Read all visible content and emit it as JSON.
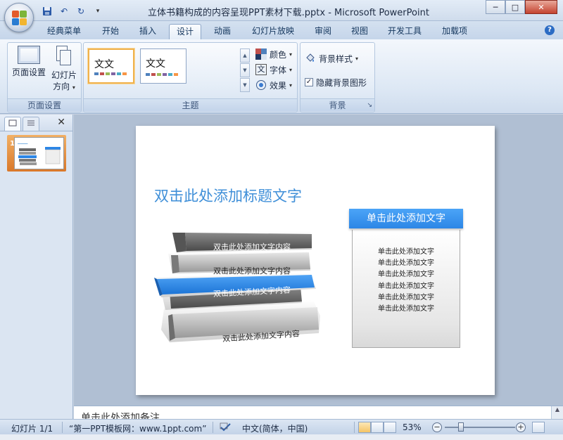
{
  "window": {
    "title": "立体书籍构成的内容呈现PPT素材下载.pptx - Microsoft PowerPoint",
    "minimize": "─",
    "maximize": "□",
    "close": "✕"
  },
  "quick_access": {
    "save_icon": "save-icon",
    "undo_label": "↶",
    "redo_label": "↻",
    "customize_label": "▾"
  },
  "tabs": [
    {
      "label": "经典菜单",
      "active": false
    },
    {
      "label": "开始",
      "active": false
    },
    {
      "label": "插入",
      "active": false
    },
    {
      "label": "设计",
      "active": true
    },
    {
      "label": "动画",
      "active": false
    },
    {
      "label": "幻灯片放映",
      "active": false
    },
    {
      "label": "审阅",
      "active": false
    },
    {
      "label": "视图",
      "active": false
    },
    {
      "label": "开发工具",
      "active": false
    },
    {
      "label": "加载项",
      "active": false
    }
  ],
  "help": "?",
  "ribbon": {
    "page_setup": {
      "group_label": "页面设置",
      "page_setup_label": "页面设置",
      "orientation_label_line1": "幻灯片",
      "orientation_label_line2": "方向",
      "orientation_caret": "▾"
    },
    "themes": {
      "group_label": "主题",
      "theme1_text": "文文",
      "theme2_text": "文文",
      "scroll_up": "▲",
      "scroll_down": "▼",
      "more": "▼",
      "colors_label": "颜色",
      "fonts_label": "字体",
      "effects_label": "效果",
      "fonts_icon_text": "文"
    },
    "background": {
      "group_label": "背景",
      "styles_label": "背景样式",
      "hide_graphics_label": "隐藏背景图形",
      "hide_graphics_checked": true,
      "check_mark": "✓",
      "launcher": "↘"
    }
  },
  "left_pane": {
    "close": "✕",
    "slide_number": "1"
  },
  "slide": {
    "title": "双击此处添加标题文字",
    "right_header": "单击此处添加文字",
    "right_lines": [
      "单击此处添加文字",
      "单击此处添加文字",
      "单击此处添加文字",
      "单击此处添加文字",
      "单击此处添加文字",
      "单击此处添加文字"
    ],
    "books": [
      "双击此处添加文字内容",
      "双击此处添加文字内容",
      "双击此处添加文字内容",
      "双击此处添加文字内容"
    ]
  },
  "notes": {
    "placeholder": "单击此处添加备注"
  },
  "status": {
    "slide_info": "幻灯片 1/1",
    "theme_name": "“第一PPT模板网：www.1ppt.com”",
    "language": "中文(简体，中国)",
    "zoom": "53%",
    "zoom_minus": "−",
    "zoom_plus": "+"
  },
  "colors": {
    "accent_blue": "#2c86e6",
    "title_blue": "#3f8fd8",
    "thumbnail_orange": "#d9782a"
  }
}
